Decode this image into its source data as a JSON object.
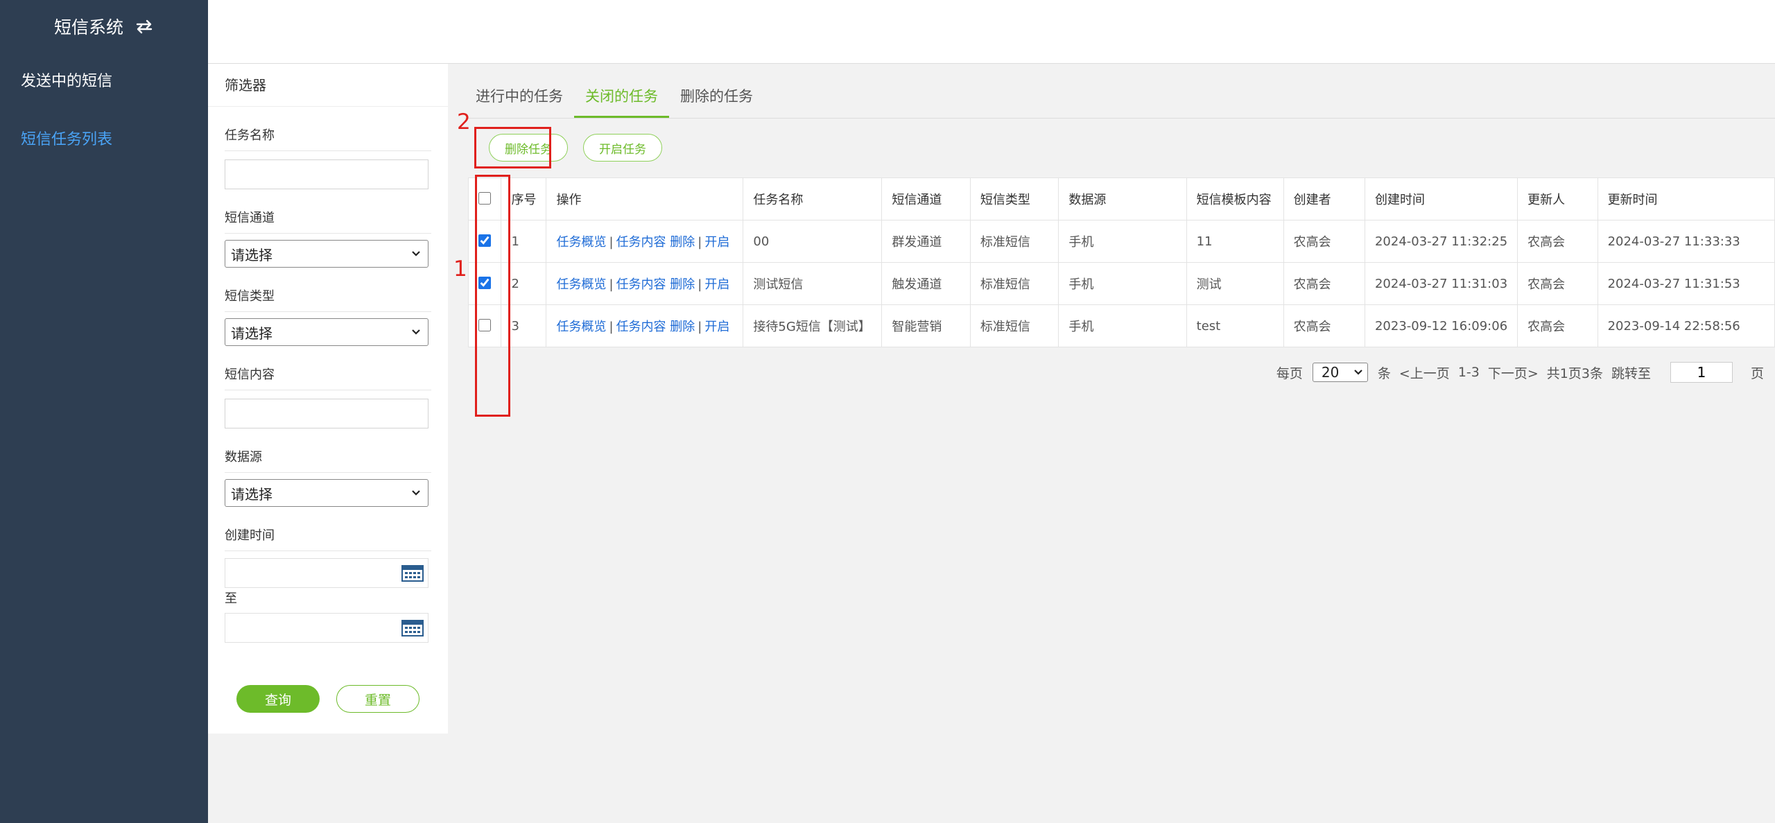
{
  "sidebar": {
    "title": "短信系统",
    "items": [
      {
        "label": "发送中的短信"
      },
      {
        "label": "短信任务列表"
      }
    ]
  },
  "filter": {
    "title": "筛选器",
    "task_name_label": "任务名称",
    "channel_label": "短信通道",
    "channel_value": "请选择",
    "type_label": "短信类型",
    "type_value": "请选择",
    "content_label": "短信内容",
    "source_label": "数据源",
    "source_value": "请选择",
    "created_label": "创建时间",
    "to_label": "至",
    "query_label": "查询",
    "reset_label": "重置"
  },
  "tabs": [
    {
      "label": "进行中的任务"
    },
    {
      "label": "关闭的任务"
    },
    {
      "label": "删除的任务"
    }
  ],
  "actions": {
    "delete_label": "删除任务",
    "enable_label": "开启任务"
  },
  "annotations": {
    "mark1": "1",
    "mark2": "2"
  },
  "table": {
    "headers": [
      "序号",
      "操作",
      "任务名称",
      "短信通道",
      "短信类型",
      "数据源",
      "短信模板内容",
      "创建者",
      "创建时间",
      "更新人",
      "更新时间"
    ],
    "op_links": [
      "任务概览",
      "任务内容",
      "删除",
      "开启"
    ],
    "rows": [
      {
        "checked": true,
        "no": "1",
        "name": "00",
        "channel": "群发通道",
        "type": "标准短信",
        "source": "手机",
        "template": "11",
        "creator": "农高会",
        "created": "2024-03-27 11:32:25",
        "updater": "农高会",
        "updated": "2024-03-27 11:33:33"
      },
      {
        "checked": true,
        "no": "2",
        "name": "测试短信",
        "channel": "触发通道",
        "type": "标准短信",
        "source": "手机",
        "template": "测试",
        "creator": "农高会",
        "created": "2024-03-27 11:31:03",
        "updater": "农高会",
        "updated": "2024-03-27 11:31:53"
      },
      {
        "checked": false,
        "no": "3",
        "name": "接待5G短信【测试】",
        "channel": "智能营销",
        "type": "标准短信",
        "source": "手机",
        "template": "test",
        "creator": "农高会",
        "created": "2023-09-12 16:09:06",
        "updater": "农高会",
        "updated": "2023-09-14 22:58:56"
      }
    ]
  },
  "pager": {
    "per_page_label": "每页",
    "page_size": "20",
    "unit_label": "条",
    "prev_label": "<上一页",
    "range": "1-3",
    "next_label": "下一页>",
    "summary": "共1页3条",
    "jump_label": "跳转至",
    "jump_value": "1",
    "page_label": "页"
  },
  "colors": {
    "sidebar_bg": "#2e3e52",
    "accent_green": "#6dbb2a",
    "link_blue": "#1e6bd6",
    "annotation_red": "#e0201c"
  }
}
